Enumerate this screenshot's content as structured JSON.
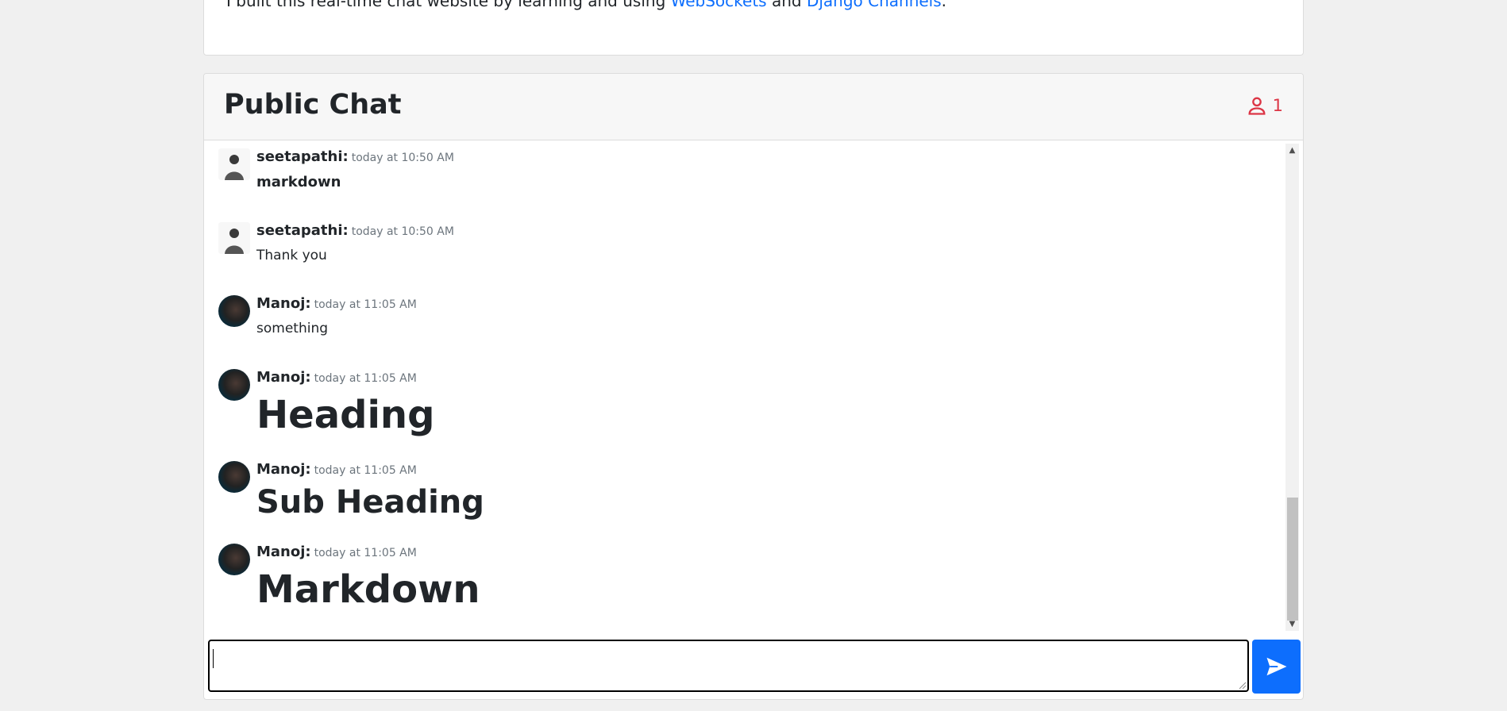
{
  "intro": {
    "text_before": "I built this real-time chat website by learning and using ",
    "link1": "WebSockets",
    "text_mid": " and ",
    "link2": "Django Channels",
    "text_after": "."
  },
  "chat": {
    "title": "Public Chat",
    "online_count": "1",
    "colors": {
      "accent": "#dc3545",
      "send_button": "#0d6efd"
    },
    "messages": [
      {
        "user": "seetapathi:",
        "time": "today at 10:50 AM",
        "text": "markdown"
      },
      {
        "user": "seetapathi:",
        "time": "today at 10:50 AM",
        "text": "Thank you"
      },
      {
        "user": "Manoj:",
        "time": "today at 11:05 AM",
        "text": "something"
      },
      {
        "user": "Manoj:",
        "time": "today at 11:05 AM",
        "text": "Heading"
      },
      {
        "user": "Manoj:",
        "time": "today at 11:05 AM",
        "text": "Sub Heading"
      },
      {
        "user": "Manoj:",
        "time": "today at 11:05 AM",
        "text": "Markdown"
      }
    ],
    "input": {
      "value": "",
      "placeholder": ""
    },
    "icons": {
      "users": "user-icon",
      "send": "send-icon"
    }
  }
}
